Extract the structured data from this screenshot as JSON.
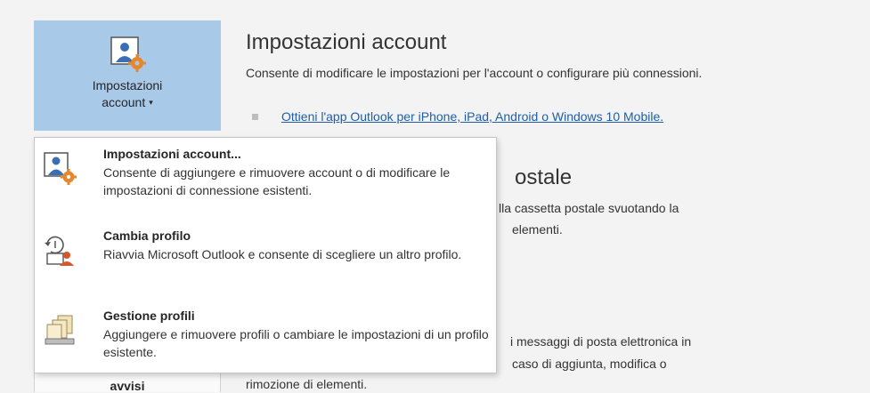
{
  "account_button": {
    "line1": "Impostazioni",
    "line2": "account",
    "caret": "▾",
    "icon": "account-settings-icon"
  },
  "section": {
    "title": "Impostazioni account",
    "description": "Consente di modificare le impostazioni per l'account o configurare più connessioni.",
    "link": "Ottieni l'app Outlook per iPhone, iPad, Android o Windows 10 Mobile."
  },
  "background": {
    "heading_partial": "ostale",
    "line1_partial": "lla cassetta postale svuotando la",
    "line2_partial": "elementi.",
    "line3_partial": "i messaggi di posta elettronica in",
    "line4_partial": "caso di aggiunta, modifica o",
    "line5_partial": "rimozione di elementi.",
    "avvisi_button": "avvisi"
  },
  "menu": {
    "items": [
      {
        "title": "Impostazioni account...",
        "description": "Consente di aggiungere e rimuovere account o di modificare le impostazioni di connessione esistenti.",
        "icon": "account-settings-icon"
      },
      {
        "title": "Cambia profilo",
        "description": "Riavvia Microsoft Outlook e consente di scegliere un altro profilo.",
        "icon": "change-profile-icon"
      },
      {
        "title": "Gestione profili",
        "description": "Aggiungere e rimuovere profili o cambiare le impostazioni di un profilo esistente.",
        "icon": "manage-profiles-icon"
      }
    ]
  },
  "colors": {
    "button_bg": "#a9c9e8",
    "link": "#1f5ea8",
    "gear": "#e8862a",
    "person": "#3a6fb5"
  }
}
